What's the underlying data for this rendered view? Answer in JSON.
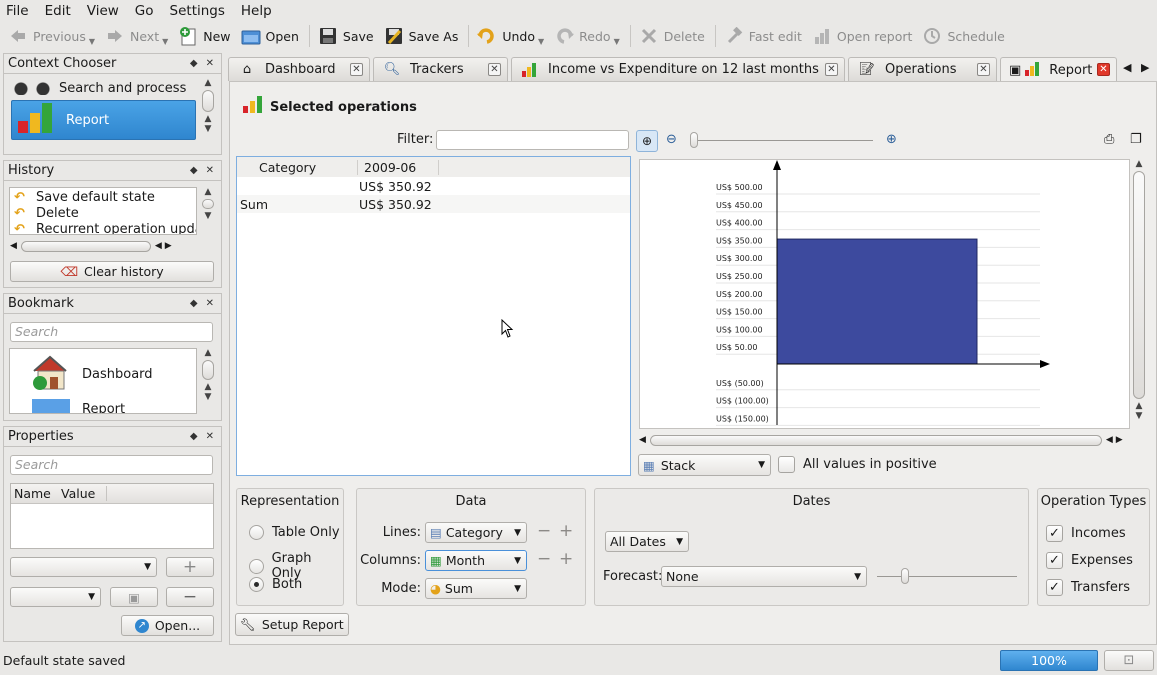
{
  "menu": [
    "File",
    "Edit",
    "View",
    "Go",
    "Settings",
    "Help"
  ],
  "toolbar": {
    "previous": "Previous",
    "next": "Next",
    "new": "New",
    "open": "Open",
    "save": "Save",
    "save_as": "Save As",
    "undo": "Undo",
    "redo": "Redo",
    "delete": "Delete",
    "fast_edit": "Fast edit",
    "open_report": "Open report",
    "schedule": "Schedule"
  },
  "context_chooser": {
    "title": "Context Chooser",
    "items": [
      "Search and process",
      "Report"
    ]
  },
  "history": {
    "title": "History",
    "items": [
      "Save default state",
      "Delete",
      "Recurrent operation updat"
    ],
    "clear_label": "Clear history"
  },
  "bookmark": {
    "title": "Bookmark",
    "search_placeholder": "Search",
    "items": [
      "Dashboard",
      "Report"
    ]
  },
  "properties": {
    "title": "Properties",
    "search_placeholder": "Search",
    "col_name": "Name",
    "col_value": "Value",
    "open_label": "Open..."
  },
  "tabs": [
    "Dashboard",
    "Trackers",
    "Income vs Expenditure on 12 last months",
    "Operations",
    "Report"
  ],
  "report": {
    "heading": "Selected operations",
    "filter_label": "Filter:",
    "table": {
      "headers": [
        "Category",
        "2009-06"
      ],
      "rows": [
        [
          "",
          "US$ 350.92"
        ],
        [
          "Sum",
          "US$ 350.92"
        ]
      ]
    },
    "stack_label": "Stack",
    "all_positive_label": "All values in positive"
  },
  "chart_data": {
    "type": "bar",
    "categories": [
      ""
    ],
    "values": [
      350.92
    ],
    "ylim": [
      -150,
      500
    ],
    "yticks": [
      "US$ 500.00",
      "US$ 450.00",
      "US$ 400.00",
      "US$ 350.00",
      "US$ 300.00",
      "US$ 250.00",
      "US$ 200.00",
      "US$ 150.00",
      "US$ 100.00",
      "US$ 50.00",
      "US$ (50.00)",
      "US$ (100.00)",
      "US$ (150.00)"
    ],
    "ytick_values": [
      500,
      450,
      400,
      350,
      300,
      250,
      200,
      150,
      100,
      50,
      -50,
      -100,
      -150
    ],
    "bar_color": "#3d4a9e",
    "grid": true
  },
  "setup": {
    "representation": {
      "title": "Representation",
      "options": [
        "Table Only",
        "Graph Only",
        "Both"
      ],
      "selected": "Both"
    },
    "data": {
      "title": "Data",
      "lines_label": "Lines:",
      "lines_value": "Category",
      "columns_label": "Columns:",
      "columns_value": "Month",
      "mode_label": "Mode:",
      "mode_value": "Sum"
    },
    "dates": {
      "title": "Dates",
      "period": "All Dates",
      "forecast_label": "Forecast:",
      "forecast_value": "None"
    },
    "operation_types": {
      "title": "Operation Types",
      "items": [
        "Incomes",
        "Expenses",
        "Transfers"
      ]
    },
    "setup_button": "Setup Report"
  },
  "status": {
    "message": "Default state saved",
    "zoom": "100%"
  }
}
